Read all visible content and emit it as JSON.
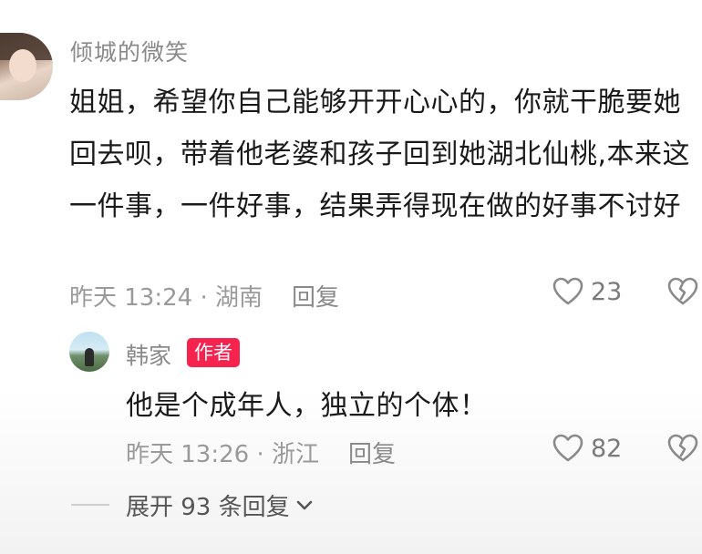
{
  "comment": {
    "username": "倾城的微笑",
    "text": "姐姐，希望你自己能够开开心心的，你就干脆要她回去呗，带着他老婆和孩子回到她湖北仙桃,本来这一件事，一件好事，结果弄得现在做的好事不讨好",
    "time_location": "昨天 13:24 · 湖南",
    "reply_label": "回复",
    "like_count": "23"
  },
  "reply": {
    "username": "韩家",
    "badge": "作者",
    "text": "他是个成年人，独立的个体！",
    "time_location": "昨天 13:26 · 浙江",
    "reply_label": "回复",
    "like_count": "82"
  },
  "expand": {
    "label": "展开 93 条回复"
  },
  "colors": {
    "badge": "#f5234e",
    "meta_text": "#9a9a9a",
    "username": "#8a8a8a"
  }
}
